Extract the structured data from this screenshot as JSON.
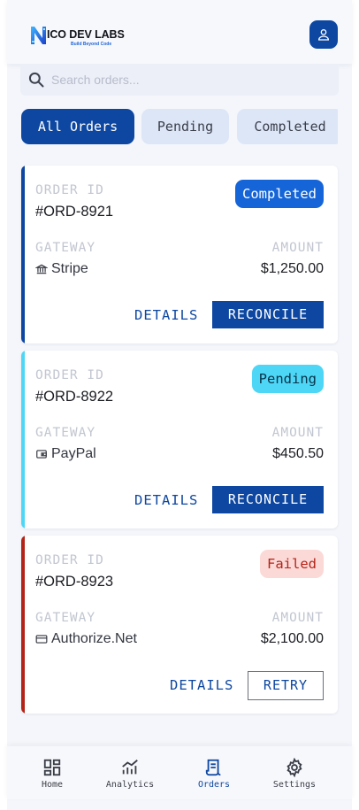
{
  "brand": {
    "title": "ICO DEV LABS",
    "tagline": "Build Beyond Code",
    "primary_color": "#0d47a1"
  },
  "header": {
    "profile_icon": "user-icon"
  },
  "search": {
    "placeholder": "Search orders...",
    "value": ""
  },
  "tabs": [
    {
      "label": "All Orders",
      "active": true
    },
    {
      "label": "Pending",
      "active": false
    },
    {
      "label": "Completed",
      "active": false
    }
  ],
  "labels": {
    "order_id": "ORDER ID",
    "gateway": "GATEWAY",
    "amount": "AMOUNT"
  },
  "orders": [
    {
      "id": "#ORD-8921",
      "status": "Completed",
      "gateway": "Stripe",
      "gateway_icon": "bank-icon",
      "amount": "$1,250.00",
      "details_label": "DETAILS",
      "action_label": "RECONCILE",
      "accent": "#0d47a1"
    },
    {
      "id": "#ORD-8922",
      "status": "Pending",
      "gateway": "PayPal",
      "gateway_icon": "wallet-icon",
      "amount": "$450.50",
      "details_label": "DETAILS",
      "action_label": "RECONCILE",
      "accent": "#4dd6f6"
    },
    {
      "id": "#ORD-8923",
      "status": "Failed",
      "gateway": "Authorize.Net",
      "gateway_icon": "credit-card-icon",
      "amount": "$2,100.00",
      "details_label": "DETAILS",
      "action_label": "RETRY",
      "accent": "#b42318"
    }
  ],
  "nav": [
    {
      "label": "Home",
      "icon": "dashboard-icon",
      "active": false
    },
    {
      "label": "Analytics",
      "icon": "analytics-icon",
      "active": false
    },
    {
      "label": "Orders",
      "icon": "receipt-icon",
      "active": true
    },
    {
      "label": "Settings",
      "icon": "gear-icon",
      "active": false
    }
  ]
}
